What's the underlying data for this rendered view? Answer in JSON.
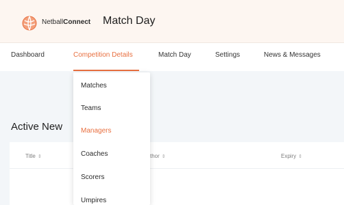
{
  "header": {
    "brand_prefix": "Netball",
    "brand_suffix": "Connect",
    "page_title": "Match Day",
    "logo_icon": "netball-icon",
    "accent": "#e86f3f"
  },
  "nav": {
    "items": [
      "Dashboard",
      "Competition Details",
      "Match Day",
      "Settings",
      "News & Messages"
    ],
    "active": "Competition Details"
  },
  "dropdown": {
    "items": [
      "Matches",
      "Teams",
      "Managers",
      "Coaches",
      "Scorers",
      "Umpires"
    ],
    "active": "Managers"
  },
  "main": {
    "section_title": "Active New",
    "columns": [
      {
        "label": "Title",
        "sort_icon": "⇕"
      },
      {
        "label": "thor",
        "sort_icon": "⇕"
      },
      {
        "label": "Expiry",
        "sort_icon": "⇕"
      }
    ]
  }
}
